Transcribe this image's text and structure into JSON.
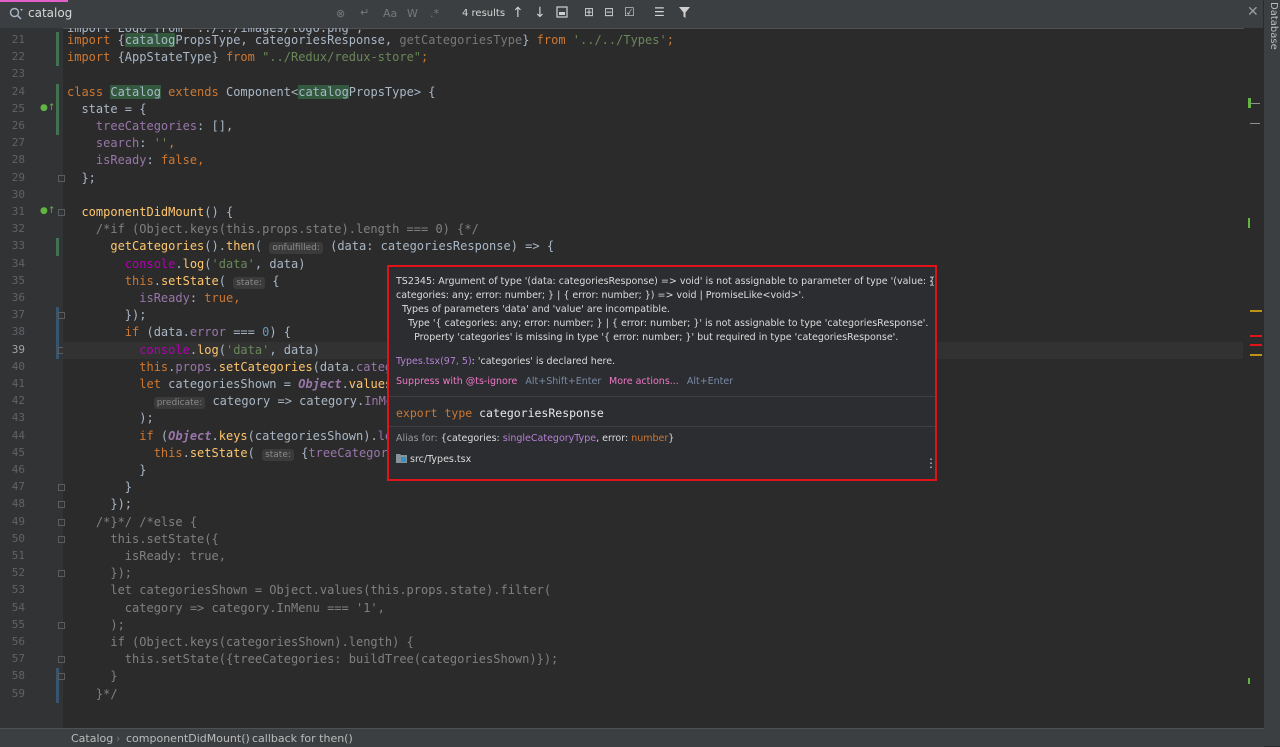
{
  "search": {
    "query": "catalog",
    "results": "4 results",
    "opt_match_case": "Aa",
    "opt_words": "W",
    "opt_regex": ".*"
  },
  "right_strip": {
    "label": "Database"
  },
  "line_numbers": [
    "21",
    "22",
    "23",
    "24",
    "25",
    "26",
    "27",
    "28",
    "29",
    "30",
    "31",
    "32",
    "33",
    "34",
    "35",
    "36",
    "37",
    "38",
    "39",
    "40",
    "41",
    "42",
    "43",
    "44",
    "45",
    "46",
    "47",
    "48",
    "49",
    "50",
    "51",
    "52",
    "53",
    "54",
    "55",
    "56",
    "57",
    "58",
    "59"
  ],
  "code": {
    "l20": "import Logo from '../../images/logo.png';",
    "l21": [
      {
        "t": "import ",
        "c": "kw"
      },
      {
        "t": "{",
        "c": "p"
      },
      {
        "t": "catalog",
        "c": "hl"
      },
      {
        "t": "PropsType, categoriesResponse, ",
        "c": "p"
      },
      {
        "t": "getCategoriesType",
        "c": "gr"
      },
      {
        "t": "} ",
        "c": "p"
      },
      {
        "t": "from ",
        "c": "kw"
      },
      {
        "t": "'../../Types'",
        "c": "s"
      },
      {
        "t": ";",
        "c": "kw"
      }
    ],
    "l22": [
      {
        "t": "import ",
        "c": "kw"
      },
      {
        "t": "{AppStateType} ",
        "c": "p"
      },
      {
        "t": "from ",
        "c": "kw"
      },
      {
        "t": "\"../Redux/redux-store\"",
        "c": "s"
      },
      {
        "t": ";",
        "c": "kw"
      }
    ],
    "l23": [],
    "l24": [
      {
        "t": "class ",
        "c": "kw"
      },
      {
        "t": "Catalog",
        "c": "hl"
      },
      {
        "t": " extends ",
        "c": "kw"
      },
      {
        "t": "Component<",
        "c": "p"
      },
      {
        "t": "catalog",
        "c": "hl"
      },
      {
        "t": "PropsType> {",
        "c": "p"
      }
    ],
    "l25": [
      {
        "t": "  state = {",
        "c": "p"
      }
    ],
    "l26": [
      {
        "t": "    treeCategories",
        "c": "f"
      },
      {
        "t": ": [],",
        "c": "p"
      }
    ],
    "l27": [
      {
        "t": "    search",
        "c": "f"
      },
      {
        "t": ": ",
        "c": "p"
      },
      {
        "t": "''",
        "c": "s"
      },
      {
        "t": ",",
        "c": "kw"
      }
    ],
    "l28": [
      {
        "t": "    isReady",
        "c": "f"
      },
      {
        "t": ": ",
        "c": "p"
      },
      {
        "t": "false",
        "c": "kw"
      },
      {
        "t": ",",
        "c": "kw"
      }
    ],
    "l29": [
      {
        "t": "  };",
        "c": "p"
      }
    ],
    "l30": [],
    "l31": [
      {
        "t": "  componentDidMount",
        "c": "fn"
      },
      {
        "t": "() {",
        "c": "p"
      }
    ],
    "l32": [
      {
        "t": "    /*if (Object.keys(this.props.state).length === 0) {*/",
        "c": "cm"
      }
    ],
    "l33": [
      {
        "t": "      getCategories",
        "c": "fn"
      },
      {
        "t": "().",
        "c": "p"
      },
      {
        "t": "then",
        "c": "fn"
      },
      {
        "t": "( ",
        "c": "p"
      },
      {
        "t": "onfulfilled:",
        "c": "hint"
      },
      {
        "t": " (data: categoriesResponse) => {",
        "c": "p"
      }
    ],
    "l34": [
      {
        "t": "        console",
        "c": "pu"
      },
      {
        "t": ".",
        "c": "p"
      },
      {
        "t": "log",
        "c": "fn"
      },
      {
        "t": "(",
        "c": "p"
      },
      {
        "t": "'data'",
        "c": "s"
      },
      {
        "t": ", data)",
        "c": "p"
      }
    ],
    "l35": [
      {
        "t": "        this",
        "c": "kw"
      },
      {
        "t": ".",
        "c": "p"
      },
      {
        "t": "setState",
        "c": "fn"
      },
      {
        "t": "( ",
        "c": "p"
      },
      {
        "t": "state:",
        "c": "hint"
      },
      {
        "t": " {",
        "c": "p"
      }
    ],
    "l36": [
      {
        "t": "          isReady",
        "c": "f"
      },
      {
        "t": ": ",
        "c": "p"
      },
      {
        "t": "true",
        "c": "kw"
      },
      {
        "t": ",",
        "c": "kw"
      }
    ],
    "l37": [
      {
        "t": "        });",
        "c": "p"
      }
    ],
    "l38": [
      {
        "t": "        if ",
        "c": "kw"
      },
      {
        "t": "(data.",
        "c": "p"
      },
      {
        "t": "error",
        "c": "f"
      },
      {
        "t": " === ",
        "c": "p"
      },
      {
        "t": "0",
        "c": "n"
      },
      {
        "t": ") {",
        "c": "p"
      }
    ],
    "l39": [
      {
        "t": "          console",
        "c": "pu"
      },
      {
        "t": ".",
        "c": "p"
      },
      {
        "t": "log",
        "c": "fn"
      },
      {
        "t": "(",
        "c": "p"
      },
      {
        "t": "'data'",
        "c": "s"
      },
      {
        "t": ", data)",
        "c": "p"
      }
    ],
    "l40": [
      {
        "t": "          this",
        "c": "kw"
      },
      {
        "t": ".",
        "c": "p"
      },
      {
        "t": "props",
        "c": "f"
      },
      {
        "t": ".",
        "c": "p"
      },
      {
        "t": "setCategories",
        "c": "fn"
      },
      {
        "t": "(data.",
        "c": "p"
      },
      {
        "t": "categor",
        "c": "f"
      }
    ],
    "l41": [
      {
        "t": "          let ",
        "c": "kw"
      },
      {
        "t": "categoriesShown = ",
        "c": "p"
      },
      {
        "t": "Object",
        "c": "it"
      },
      {
        "t": ".",
        "c": "p"
      },
      {
        "t": "values",
        "c": "fn"
      },
      {
        "t": "(t",
        "c": "p"
      }
    ],
    "l42": [
      {
        "t": "            ",
        "c": "p"
      },
      {
        "t": "predicate:",
        "c": "hint"
      },
      {
        "t": " category => category.",
        "c": "p"
      },
      {
        "t": "InMenu",
        "c": "f"
      }
    ],
    "l43": [
      {
        "t": "          );",
        "c": "p"
      }
    ],
    "l44": [
      {
        "t": "          if ",
        "c": "kw"
      },
      {
        "t": "(",
        "c": "p"
      },
      {
        "t": "Object",
        "c": "it"
      },
      {
        "t": ".",
        "c": "p"
      },
      {
        "t": "keys",
        "c": "fn"
      },
      {
        "t": "(categoriesShown).",
        "c": "p"
      },
      {
        "t": "leng",
        "c": "f"
      }
    ],
    "l45": [
      {
        "t": "            this",
        "c": "kw"
      },
      {
        "t": ".",
        "c": "p"
      },
      {
        "t": "setState",
        "c": "fn"
      },
      {
        "t": "( ",
        "c": "p"
      },
      {
        "t": "state:",
        "c": "hint"
      },
      {
        "t": " {",
        "c": "p"
      },
      {
        "t": "treeCategories",
        "c": "f"
      },
      {
        "t": ":",
        "c": "p"
      }
    ],
    "l46": [
      {
        "t": "          }",
        "c": "p"
      }
    ],
    "l47": [
      {
        "t": "        }",
        "c": "p"
      }
    ],
    "l48": [
      {
        "t": "      });",
        "c": "p"
      }
    ],
    "l49": [
      {
        "t": "    /*}*/ /*else {",
        "c": "cm"
      }
    ],
    "l50": [
      {
        "t": "      this.setState({",
        "c": "cm"
      }
    ],
    "l51": [
      {
        "t": "        isReady: true,",
        "c": "cm"
      }
    ],
    "l52": [
      {
        "t": "      });",
        "c": "cm"
      }
    ],
    "l53": [
      {
        "t": "      let categoriesShown = Object.values(this.props.state).filter(",
        "c": "cm"
      }
    ],
    "l54": [
      {
        "t": "        category => category.InMenu === '1',",
        "c": "cm"
      }
    ],
    "l55": [
      {
        "t": "      );",
        "c": "cm"
      }
    ],
    "l56": [
      {
        "t": "      if (Object.keys(categoriesShown).length) {",
        "c": "cm"
      }
    ],
    "l57": [
      {
        "t": "        this.setState({treeCategories: buildTree(categoriesShown)});",
        "c": "cm"
      }
    ],
    "l58": [
      {
        "t": "      }",
        "c": "cm"
      }
    ],
    "l59": [
      {
        "t": "    }*/",
        "c": "cm"
      }
    ]
  },
  "popup": {
    "error_line1": "TS2345: Argument of type '(data: categoriesResponse) => void' is not assignable to parameter of type '(value: {",
    "error_line2": "categories: any; error: number; } | { error: number; }) => void | PromiseLike<void>'.",
    "error_line3": "  Types of parameters 'data' and 'value' are incompatible.",
    "error_line4": "    Type '{ categories: any; error: number; } | { error: number; }' is not assignable to type 'categoriesResponse'.",
    "error_line5": "      Property 'categories' is missing in type '{ error: number; }' but required in type 'categoriesResponse'.",
    "declared_link": "Types.tsx(97, 5)",
    "declared_text": ": 'categories' is declared here.",
    "suppress_label": "Suppress with @ts-ignore",
    "suppress_shortcut": "Alt+Shift+Enter",
    "more_label": "More actions...",
    "more_shortcut": "Alt+Enter",
    "decl_kw1": "export",
    "decl_kw2": "type",
    "decl_name": "categoriesResponse",
    "alias_label": "Alias for:",
    "alias_open": "{categories: ",
    "alias_type1": "singleCategoryType",
    "alias_mid": ", error: ",
    "alias_type2": "number",
    "alias_close": "}",
    "file_path": "src/Types.tsx"
  },
  "breadcrumb": {
    "item1": "Catalog",
    "item2": "componentDidMount()",
    "item3": "callback for then()"
  },
  "colors": {
    "kw": "#cc7832",
    "p": "#a9b7c6",
    "s": "#6a8759",
    "f": "#9876aa",
    "fn": "#ffc66d",
    "cm": "#808080",
    "n": "#6897bb",
    "pu": "#b200b2",
    "hl_bg": "#32593d",
    "error_border": "#e0121a"
  }
}
